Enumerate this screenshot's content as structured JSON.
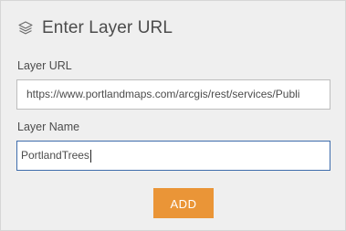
{
  "header": {
    "icon": "layers-icon",
    "title": "Enter Layer URL"
  },
  "form": {
    "url_label": "Layer URL",
    "url_value": "https://www.portlandmaps.com/arcgis/rest/services/Publi",
    "name_label": "Layer Name",
    "name_value": "PortlandTrees",
    "add_label": "ADD"
  },
  "colors": {
    "panel_bg": "#efefef",
    "accent": "#ea9537",
    "focus_border": "#3f6dac",
    "text": "#4c4c4c"
  }
}
